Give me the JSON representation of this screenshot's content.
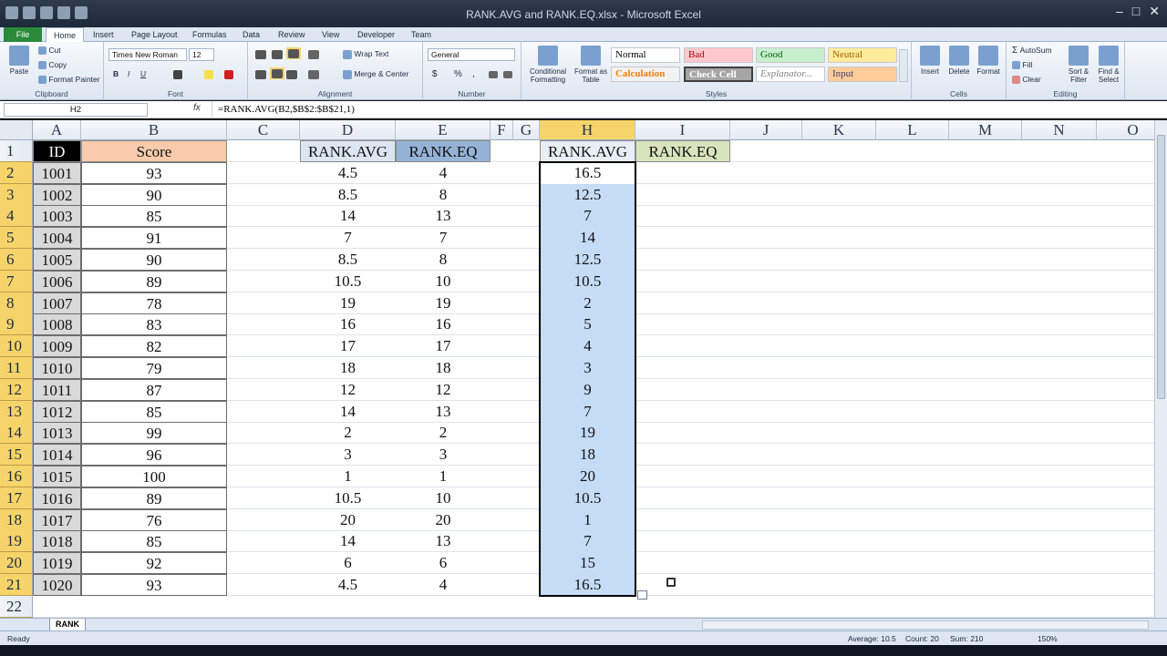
{
  "window": {
    "title": "RANK.AVG and RANK.EQ.xlsx - Microsoft Excel"
  },
  "tabs": [
    "File",
    "Home",
    "Insert",
    "Page Layout",
    "Formulas",
    "Data",
    "Review",
    "View",
    "Developer",
    "Team"
  ],
  "ribbon": {
    "clipboard": {
      "label": "Clipboard",
      "paste": "Paste",
      "cut": "Cut",
      "copy": "Copy",
      "format_painter": "Format Painter"
    },
    "font": {
      "label": "Font",
      "family": "Times New Roman",
      "size": "12",
      "bold": "B",
      "italic": "I",
      "underline": "U"
    },
    "alignment": {
      "label": "Alignment",
      "wrap_text": "Wrap Text",
      "merge_center": "Merge & Center"
    },
    "number": {
      "label": "Number",
      "format": "General",
      "currency": "$",
      "percent": "%",
      "comma": ","
    },
    "styles": {
      "label": "Styles",
      "conditional": "Conditional Formatting",
      "format_table": "Format as Table",
      "cells": [
        {
          "name": "Normal",
          "bg": "#ffffff",
          "fg": "#000000"
        },
        {
          "name": "Bad",
          "bg": "#ffc7ce",
          "fg": "#9c0006"
        },
        {
          "name": "Good",
          "bg": "#c6efce",
          "fg": "#006100"
        },
        {
          "name": "Neutral",
          "bg": "#ffeb9c",
          "fg": "#9c6500"
        },
        {
          "name": "Calculation",
          "bg": "#f2f2f2",
          "fg": "#fa7d00"
        },
        {
          "name": "Check Cell",
          "bg": "#a5a5a5",
          "fg": "#ffffff"
        },
        {
          "name": "Explanator...",
          "bg": "#ffffff",
          "fg": "#7f7f7f"
        },
        {
          "name": "Input",
          "bg": "#ffcc99",
          "fg": "#3f3f76"
        }
      ]
    },
    "cells": {
      "label": "Cells",
      "insert": "Insert",
      "delete": "Delete",
      "format": "Format"
    },
    "editing": {
      "label": "Editing",
      "autosum": "AutoSum",
      "fill": "Fill",
      "clear": "Clear",
      "sort_filter": "Sort & Filter",
      "find_select": "Find & Select"
    }
  },
  "formula_bar": {
    "name_box": "H2",
    "fx": "fx",
    "formula": "=RANK.AVG(B2,$B$2:$B$21,1)"
  },
  "columns": [
    "A",
    "B",
    "C",
    "D",
    "E",
    "F",
    "G",
    "H",
    "I",
    "J",
    "K",
    "L",
    "M",
    "N",
    "O"
  ],
  "rows": [
    "1",
    "2",
    "3",
    "4",
    "5",
    "6",
    "7",
    "8",
    "9",
    "10",
    "11",
    "12",
    "13",
    "14",
    "15",
    "16",
    "17",
    "18",
    "19",
    "20",
    "21",
    "22"
  ],
  "headers": {
    "A": "ID",
    "B": "Score",
    "D": "RANK.AVG",
    "E": "RANK.EQ",
    "H": "RANK.AVG",
    "I": "RANK.EQ"
  },
  "header_colors": {
    "A": "#000000",
    "B": "#f8cbad",
    "D": "#dce6f1",
    "E": "#95b3d7",
    "H": "#e8eef5",
    "I": "#d8e4bc"
  },
  "data": {
    "ids": [
      "1001",
      "1002",
      "1003",
      "1004",
      "1005",
      "1006",
      "1007",
      "1008",
      "1009",
      "1010",
      "1011",
      "1012",
      "1013",
      "1014",
      "1015",
      "1016",
      "1017",
      "1018",
      "1019",
      "1020"
    ],
    "scores": [
      "93",
      "90",
      "85",
      "91",
      "90",
      "89",
      "78",
      "83",
      "82",
      "79",
      "87",
      "85",
      "99",
      "96",
      "100",
      "89",
      "76",
      "85",
      "92",
      "93"
    ],
    "rank_avg_desc": [
      "4.5",
      "8.5",
      "14",
      "7",
      "8.5",
      "10.5",
      "19",
      "16",
      "17",
      "18",
      "12",
      "14",
      "2",
      "3",
      "1",
      "10.5",
      "20",
      "14",
      "6",
      "4.5"
    ],
    "rank_eq_desc": [
      "4",
      "8",
      "13",
      "7",
      "8",
      "10",
      "19",
      "16",
      "17",
      "18",
      "12",
      "13",
      "2",
      "3",
      "1",
      "10",
      "20",
      "13",
      "6",
      "4"
    ],
    "rank_avg_asc": [
      "16.5",
      "12.5",
      "7",
      "14",
      "12.5",
      "10.5",
      "2",
      "5",
      "4",
      "3",
      "9",
      "7",
      "19",
      "18",
      "20",
      "10.5",
      "1",
      "7",
      "15",
      "16.5"
    ]
  },
  "selection_color": "#c5dcf7",
  "sheet_tabs": [
    "RANK"
  ],
  "status": {
    "ready": "Ready",
    "average": "Average: 10.5",
    "count": "Count: 20",
    "sum": "Sum: 210",
    "zoom": "150%"
  }
}
